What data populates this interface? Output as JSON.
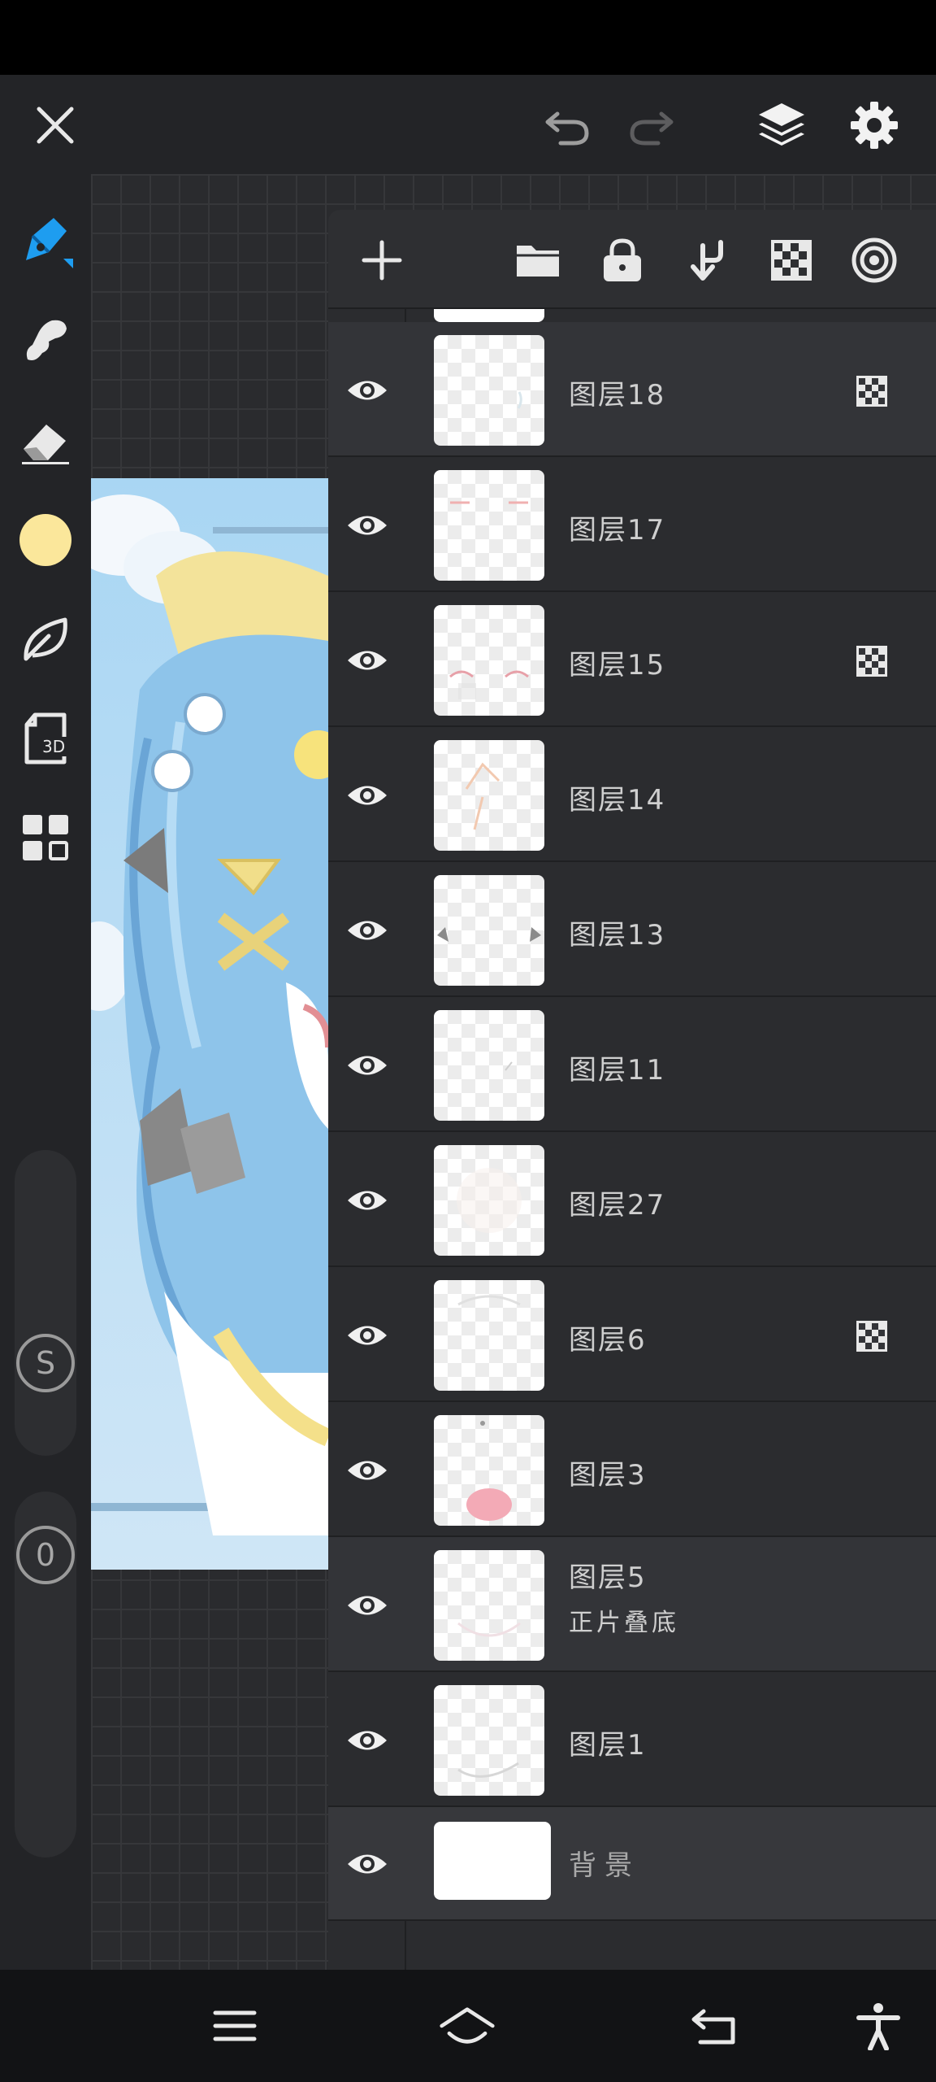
{
  "layers": [
    {
      "name": "图层18",
      "subtitle": "",
      "alpha_lock": true
    },
    {
      "name": "图层17",
      "subtitle": "",
      "alpha_lock": false
    },
    {
      "name": "图层15",
      "subtitle": "",
      "alpha_lock": true
    },
    {
      "name": "图层14",
      "subtitle": "",
      "alpha_lock": false
    },
    {
      "name": "图层13",
      "subtitle": "",
      "alpha_lock": false
    },
    {
      "name": "图层11",
      "subtitle": "",
      "alpha_lock": false
    },
    {
      "name": "图层27",
      "subtitle": "",
      "alpha_lock": false
    },
    {
      "name": "图层6",
      "subtitle": "",
      "alpha_lock": true
    },
    {
      "name": "图层3",
      "subtitle": "",
      "alpha_lock": false
    },
    {
      "name": "图层5",
      "subtitle": "正片叠底",
      "alpha_lock": false
    },
    {
      "name": "图层1",
      "subtitle": "",
      "alpha_lock": false
    },
    {
      "name": "背景",
      "subtitle": "",
      "alpha_lock": false
    }
  ],
  "toolbar": {
    "stabilizer_label": "S",
    "opacity_label": "0",
    "tool_3d_label": "3D"
  },
  "colors": {
    "accent": "#1e9df0",
    "current_color": "#fbe79b",
    "panel_bg": "#2b2c2f",
    "selected_row_bg": "#333438"
  },
  "icons": {
    "top": [
      "close-icon",
      "undo-icon",
      "redo-icon",
      "layers-icon",
      "settings-icon"
    ],
    "panel": [
      "add-layer-icon",
      "folder-icon",
      "lock-icon",
      "merge-down-icon",
      "alpha-lock-icon",
      "reference-icon"
    ],
    "tools": [
      "brush-icon",
      "smudge-icon",
      "eraser-icon",
      "color-swatch",
      "leaf-icon",
      "3d-icon",
      "materials-icon"
    ],
    "nav": [
      "menu-icon",
      "home-icon",
      "back-icon",
      "accessibility-icon"
    ]
  }
}
